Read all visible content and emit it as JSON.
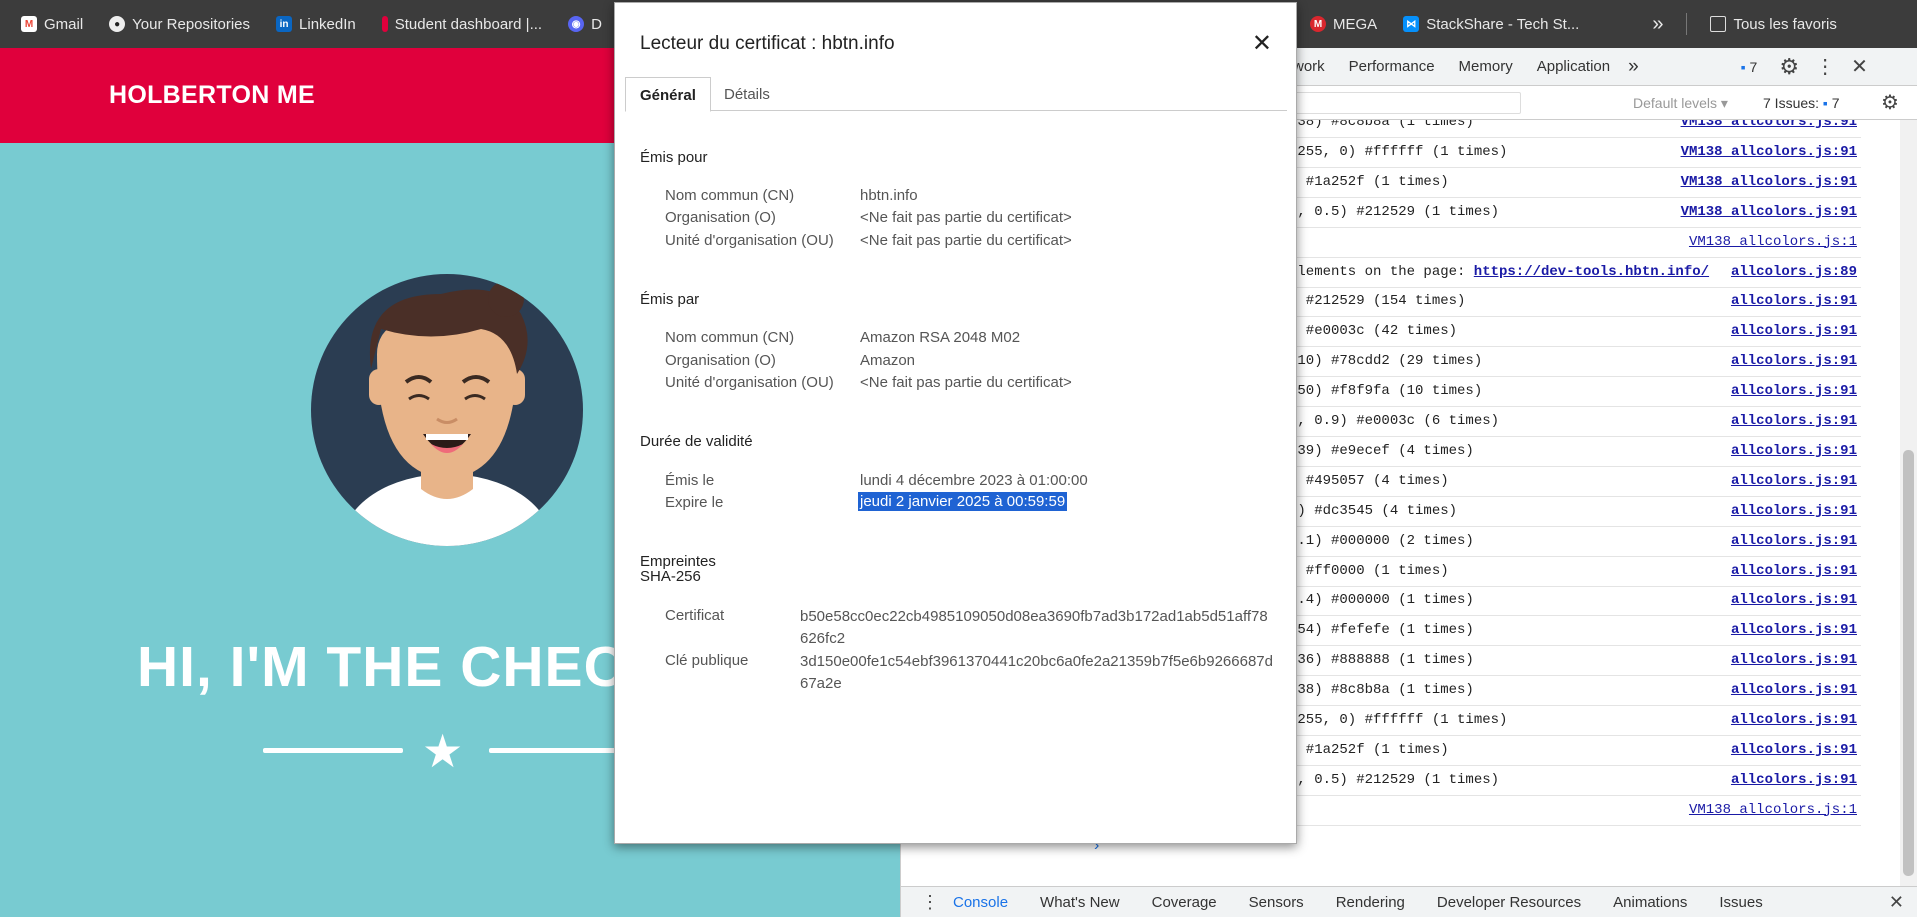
{
  "bookmarks": [
    {
      "label": "Gmail",
      "color": "#ea4335",
      "icon": "gmail-icon"
    },
    {
      "label": "Your Repositories",
      "color": "#222222",
      "icon": "github-icon"
    },
    {
      "label": "LinkedIn",
      "color": "#0a66c2",
      "icon": "linkedin-icon"
    },
    {
      "label": "Student dashboard |...",
      "color": "#e0003c",
      "icon": "holberton-icon"
    },
    {
      "label": "D",
      "color": "#5865f2",
      "icon": "discord-icon"
    }
  ],
  "bookmarks_right": [
    {
      "label": "MEGA",
      "color": "#d9272e",
      "icon": "mega-icon"
    },
    {
      "label": "StackShare - Tech St...",
      "color": "#0690fa",
      "icon": "stackshare-icon"
    }
  ],
  "bookmarks_more": "»",
  "bookmarks_all": "Tous les favoris",
  "site": {
    "brand": "HOLBERTON ME",
    "hero": "HI, I'M THE CHEC",
    "header_color": "#e0003c",
    "bg_color": "#78cbd1"
  },
  "devtools": {
    "tabs": [
      "work",
      "Performance",
      "Memory",
      "Application"
    ],
    "more": "»",
    "badge_count": "7",
    "default_levels": "Default levels",
    "issues_label": "7 Issues:",
    "issues_count": "7",
    "drawer_tabs": [
      "Console",
      "What's New",
      "Coverage",
      "Sensors",
      "Rendering",
      "Developer Resources",
      "Animations",
      "Issues"
    ],
    "rows": [
      {
        "msg": "138) #8c8b8a (1 times)",
        "src": "VM138 allcolors.js:91",
        "bold": true
      },
      {
        "msg": " 255, 0) #ffffff (1 times)",
        "src": "VM138 allcolors.js:91",
        "bold": true
      },
      {
        "msg": ") #1a252f (1 times)",
        "src": "VM138 allcolors.js:91",
        "bold": true
      },
      {
        "msg": "1, 0.5) #212529 (1 times)",
        "src": "VM138 allcolors.js:91",
        "bold": true
      },
      {
        "msg": "",
        "src": "VM138 allcolors.js:1",
        "bold": false
      },
      {
        "msg": "elements on the page: ",
        "link": "https://dev-tools.hbtn.info/",
        "src": "allcolors.js:89",
        "bold": true
      },
      {
        "msg": ") #212529 (154 times)",
        "src": "allcolors.js:91",
        "bold": true
      },
      {
        "msg": ") #e0003c (42 times)",
        "src": "allcolors.js:91",
        "bold": true
      },
      {
        "msg": "210) #78cdd2 (29 times)",
        "src": "allcolors.js:91",
        "bold": true
      },
      {
        "msg": "250) #f8f9fa (10 times)",
        "src": "allcolors.js:91",
        "bold": true
      },
      {
        "msg": "0, 0.9) #e0003c (6 times)",
        "src": "allcolors.js:91",
        "bold": true
      },
      {
        "msg": "239) #e9ecef (4 times)",
        "src": "allcolors.js:91",
        "bold": true
      },
      {
        "msg": ") #495057 (4 times)",
        "src": "allcolors.js:91",
        "bold": true
      },
      {
        "msg": "9) #dc3545 (4 times)",
        "src": "allcolors.js:91",
        "bold": true
      },
      {
        "msg": "0.1) #000000 (2 times)",
        "src": "allcolors.js:91",
        "bold": true
      },
      {
        "msg": ") #ff0000 (1 times)",
        "src": "allcolors.js:91",
        "bold": true
      },
      {
        "msg": "0.4) #000000 (1 times)",
        "src": "allcolors.js:91",
        "bold": true
      },
      {
        "msg": "254) #fefefe (1 times)",
        "src": "allcolors.js:91",
        "bold": true
      },
      {
        "msg": "136) #888888 (1 times)",
        "src": "allcolors.js:91",
        "bold": true
      },
      {
        "msg": "138) #8c8b8a (1 times)",
        "src": "allcolors.js:91",
        "bold": true
      },
      {
        "msg": " 255, 0) #ffffff (1 times)",
        "src": "allcolors.js:91",
        "bold": true
      },
      {
        "msg": ") #1a252f (1 times)",
        "src": "allcolors.js:91",
        "bold": true
      },
      {
        "msg": "1, 0.5) #212529 (1 times)",
        "src": "allcolors.js:91",
        "bold": true
      },
      {
        "msg": "",
        "src": "VM138 allcolors.js:1",
        "bold": false
      }
    ]
  },
  "dialog": {
    "title": "Lecteur du certificat : hbtn.info",
    "close": "✕",
    "tab_general": "Général",
    "tab_details": "Détails",
    "issued_to": {
      "heading": "Émis pour",
      "rows": [
        {
          "k": "Nom commun (CN)",
          "v": "hbtn.info"
        },
        {
          "k": "Organisation (O)",
          "v": "<Ne fait pas partie du certificat>"
        },
        {
          "k": "Unité d'organisation (OU)",
          "v": "<Ne fait pas partie du certificat>"
        }
      ]
    },
    "issued_by": {
      "heading": "Émis par",
      "rows": [
        {
          "k": "Nom commun (CN)",
          "v": "Amazon RSA 2048 M02"
        },
        {
          "k": "Organisation (O)",
          "v": "Amazon"
        },
        {
          "k": "Unité d'organisation (OU)",
          "v": "<Ne fait pas partie du certificat>"
        }
      ]
    },
    "validity": {
      "heading": "Durée de validité",
      "issued_label": "Émis le",
      "issued_value": "lundi 4 décembre 2023 à 01:00:00",
      "expires_label": "Expire le",
      "expires_value": "jeudi 2 janvier 2025 à 00:59:59"
    },
    "fingerprints": {
      "heading": "Empreintes SHA-256",
      "cert_label": "Certificat",
      "cert_value": "b50e58cc0ec22cb4985109050d08ea3690fb7ad3b172ad1ab5d51aff78626fc2",
      "pubkey_label": "Clé publique",
      "pubkey_value": "3d150e00fe1c54ebf3961370441c20bc6a0fe2a21359b7f5e6b9266687d67a2e"
    }
  }
}
